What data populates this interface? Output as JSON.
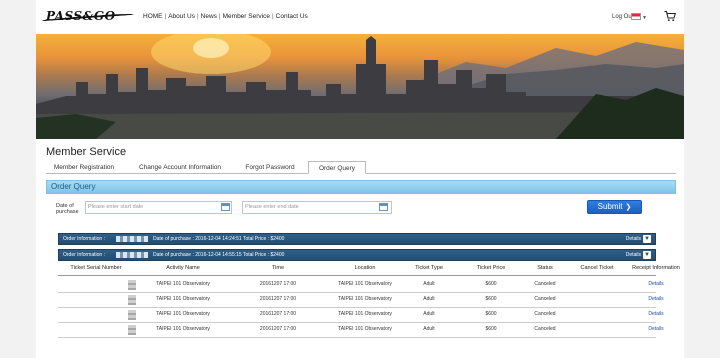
{
  "header": {
    "logo_text": "PASS&GO",
    "nav": [
      "HOME",
      "About Us",
      "News",
      "Member Service",
      "Contact Us"
    ],
    "nav_separator": "|",
    "logout_label": "Log Out",
    "cart_icon": "cart-icon"
  },
  "page": {
    "title": "Member Service",
    "tabs": [
      "Member Registration",
      "Change Account Information",
      "Forgot Password",
      "Order Query"
    ],
    "active_tab": "Order Query"
  },
  "order_query": {
    "bar_title": "Order Query",
    "date_label": "Date of purchase",
    "start_placeholder": "Please enter start date",
    "end_placeholder": "Please enter end date",
    "dash": "-",
    "submit_label": "Submit"
  },
  "orders": [
    {
      "label": "Order Information :",
      "info": "Date of purchase : 2016-12-04 14:24:51   Total Price : $2400",
      "details_label": "Details"
    },
    {
      "label": "Order Information :",
      "info": "Date of purchase : 2016-12-04 14:55:15   Total Price : $2400",
      "details_label": "Details"
    }
  ],
  "table": {
    "headers": [
      "Ticket Serial Number",
      "Activity Name",
      "Time",
      "Location",
      "Ticket Type",
      "Ticket Price",
      "Status",
      "Cancel Ticket",
      "Receipt Information"
    ],
    "rows": [
      {
        "activity": "TAIPEI 101 Observatory",
        "time": "20161207 17:00",
        "location": "TAIPEI 101 Observatory",
        "type": "Adult",
        "price": "$600",
        "status": "Canceled",
        "cancel": "",
        "receipt": "Details"
      },
      {
        "activity": "TAIPEI 101 Observatory",
        "time": "20161207 17:00",
        "location": "TAIPEI 101 Observatory",
        "type": "Adult",
        "price": "$600",
        "status": "Canceled",
        "cancel": "",
        "receipt": "Details"
      },
      {
        "activity": "TAIPEI 101 Observatory",
        "time": "20161207 17:00",
        "location": "TAIPEI 101 Observatory",
        "type": "Adult",
        "price": "$600",
        "status": "Canceled",
        "cancel": "",
        "receipt": "Details"
      },
      {
        "activity": "TAIPEI 101 Observatory",
        "time": "20161207 17:00",
        "location": "TAIPEI 101 Observatory",
        "type": "Adult",
        "price": "$600",
        "status": "Canceled",
        "cancel": "",
        "receipt": "Details"
      }
    ]
  },
  "colors": {
    "query_bar": "#7cc6e9",
    "order_row": "#234d71",
    "submit": "#1a5fc3"
  }
}
